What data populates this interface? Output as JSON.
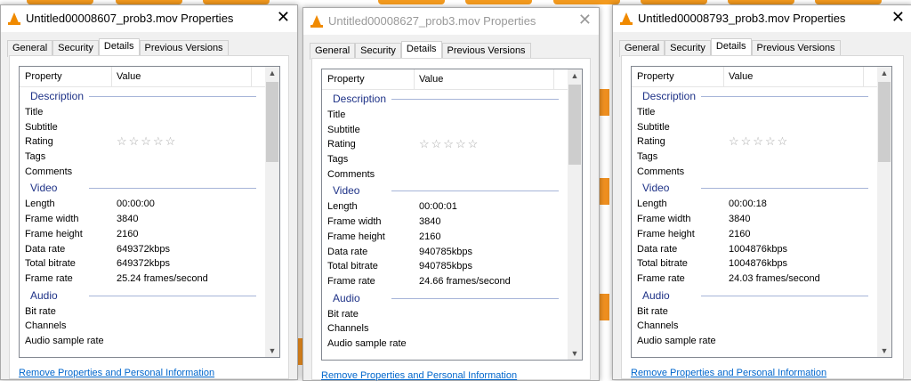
{
  "dialogs": [
    {
      "title": "Untitled00008607_prob3.mov Properties",
      "active": true,
      "values": {
        "length": "00:00:00",
        "frame_width": "3840",
        "frame_height": "2160",
        "data_rate": "649372kbps",
        "total_bitrate": "649372kbps",
        "frame_rate": "25.24 frames/second"
      }
    },
    {
      "title": "Untitled00008627_prob3.mov Properties",
      "active": false,
      "values": {
        "length": "00:00:01",
        "frame_width": "3840",
        "frame_height": "2160",
        "data_rate": "940785kbps",
        "total_bitrate": "940785kbps",
        "frame_rate": "24.66 frames/second"
      }
    },
    {
      "title": "Untitled00008793_prob3.mov Properties",
      "active": true,
      "values": {
        "length": "00:00:18",
        "frame_width": "3840",
        "frame_height": "2160",
        "data_rate": "1004876kbps",
        "total_bitrate": "1004876kbps",
        "frame_rate": "24.03 frames/second"
      }
    }
  ],
  "tabs": [
    "General",
    "Security",
    "Details",
    "Previous Versions"
  ],
  "columns": {
    "property": "Property",
    "value": "Value"
  },
  "groups": {
    "description": "Description",
    "video": "Video",
    "audio": "Audio"
  },
  "labels": {
    "title": "Title",
    "subtitle": "Subtitle",
    "rating": "Rating",
    "tags": "Tags",
    "comments": "Comments",
    "length": "Length",
    "frame_width": "Frame width",
    "frame_height": "Frame height",
    "data_rate": "Data rate",
    "total_bitrate": "Total bitrate",
    "frame_rate": "Frame rate",
    "bit_rate": "Bit rate",
    "channels": "Channels",
    "audio_sample_rate": "Audio sample rate"
  },
  "rating_stars": "☆☆☆☆☆",
  "close_glyph": "✕",
  "link": "Remove Properties and Personal Information"
}
